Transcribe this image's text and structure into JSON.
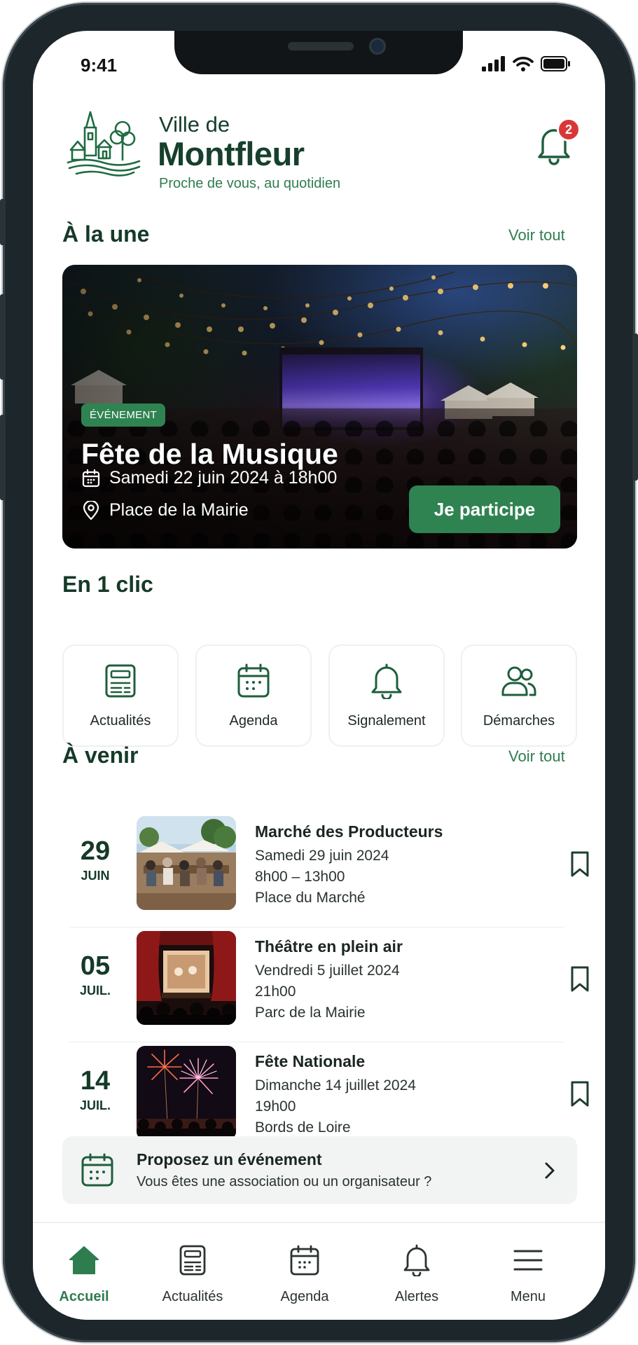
{
  "status_bar": {
    "time": "9:41"
  },
  "header": {
    "brand_prefix": "Ville de",
    "brand_name": "Montfleur",
    "tagline": "Proche de vous, au quotidien",
    "notification_count": "2"
  },
  "featured": {
    "section_title": "À la une",
    "see_all": "Voir tout",
    "badge": "ÉVÉNEMENT",
    "title": "Fête de la Musique",
    "date": "Samedi 22 juin 2024 à 18h00",
    "location": "Place de la Mairie",
    "cta": "Je participe"
  },
  "quick_access": {
    "section_title": "En 1 clic",
    "items": [
      {
        "label": "Actualités",
        "icon": "newspaper-icon"
      },
      {
        "label": "Agenda",
        "icon": "calendar-icon"
      },
      {
        "label": "Signalement",
        "icon": "bell-icon"
      },
      {
        "label": "Démarches",
        "icon": "users-icon"
      }
    ]
  },
  "upcoming": {
    "section_title": "À venir",
    "see_all": "Voir tout",
    "events": [
      {
        "day": "29",
        "month": "JUIN",
        "title": "Marché des Producteurs",
        "date": "Samedi 29 juin 2024",
        "time": "8h00 – 13h00",
        "place": "Place du Marché"
      },
      {
        "day": "05",
        "month": "JUIL.",
        "title": "Théâtre en plein air",
        "date": "Vendredi 5 juillet 2024",
        "time": "21h00",
        "place": "Parc de la Mairie"
      },
      {
        "day": "14",
        "month": "JUIL.",
        "title": "Fête Nationale",
        "date": "Dimanche 14 juillet 2024",
        "time": "19h00",
        "place": "Bords de Loire"
      }
    ]
  },
  "propose": {
    "title": "Proposez un événement",
    "subtitle": "Vous êtes une association ou un organisateur ?"
  },
  "tabbar": {
    "items": [
      {
        "label": "Accueil",
        "icon": "home-icon",
        "active": true
      },
      {
        "label": "Actualités",
        "icon": "newspaper-icon",
        "active": false
      },
      {
        "label": "Agenda",
        "icon": "calendar-icon",
        "active": false
      },
      {
        "label": "Alertes",
        "icon": "bell-icon",
        "active": false
      },
      {
        "label": "Menu",
        "icon": "menu-icon",
        "active": false
      }
    ]
  },
  "colors": {
    "brand_dark": "#153a28",
    "brand_green": "#2e7d4f",
    "button_green": "#2f8351",
    "badge_red": "#d93737"
  }
}
